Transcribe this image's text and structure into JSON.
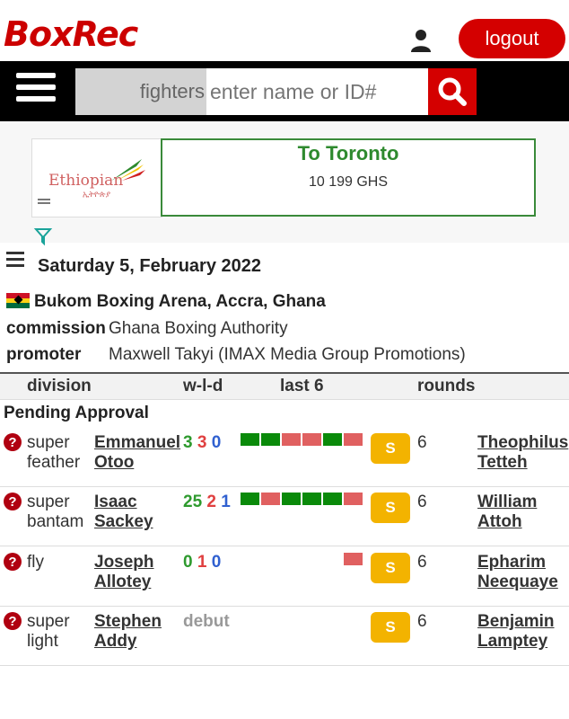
{
  "header": {
    "logo": "BoxRec",
    "logout_label": "logout"
  },
  "search": {
    "type_label": "fighters",
    "placeholder": "enter name or ID#"
  },
  "ad": {
    "brand": "Ethiopian",
    "brand_sub": "ኢትዮጵያ",
    "destination": "To Toronto",
    "price": "10 199 GHS"
  },
  "event": {
    "date": "Saturday 5, February 2022",
    "venue": "Bukom Boxing Arena, Accra, Ghana",
    "commission_label": "commission",
    "commission": "Ghana Boxing Authority",
    "promoter_label": "promoter",
    "promoter": "Maxwell Takyi (IMAX Media Group Promotions)"
  },
  "table": {
    "columns": [
      "division",
      "w-l-d",
      "last 6",
      "rounds"
    ],
    "group": "Pending Approval",
    "bouts": [
      {
        "div1": "super",
        "div2": "feather",
        "a1": "Emmanuel",
        "a2": "Otoo",
        "w": "3",
        "l": "3",
        "d": "0",
        "last6": [
          "win",
          "win",
          "loss",
          "loss",
          "win",
          "loss"
        ],
        "badge": "S",
        "rounds": "6",
        "b1": "Theophilus",
        "b2": "Tetteh"
      },
      {
        "div1": "super",
        "div2": "bantam",
        "a1": "Isaac",
        "a2": "Sackey",
        "w": "25",
        "l": "2",
        "d": "1",
        "last6": [
          "win",
          "loss",
          "win",
          "win",
          "win",
          "loss"
        ],
        "badge": "S",
        "rounds": "6",
        "b1": "William",
        "b2": "Attoh"
      },
      {
        "div1": "fly",
        "div2": "",
        "a1": "Joseph",
        "a2": "Allotey",
        "w": "0",
        "l": "1",
        "d": "0",
        "last6": [
          "",
          "",
          "",
          "",
          "",
          "loss"
        ],
        "badge": "S",
        "rounds": "6",
        "b1": "Epharim",
        "b2": "Neequaye"
      },
      {
        "div1": "super",
        "div2": "light",
        "a1": "Stephen",
        "a2": "Addy",
        "debut": "debut",
        "last6": [
          "",
          "",
          "",
          "",
          "",
          ""
        ],
        "badge": "S",
        "rounds": "6",
        "b1": "Benjamin",
        "b2": "Lamptey"
      }
    ]
  }
}
